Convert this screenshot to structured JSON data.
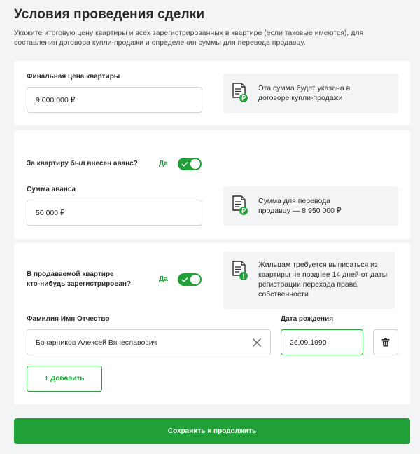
{
  "page": {
    "title": "Условия проведения сделки",
    "subtitle": "Укажите итоговую цену квартиры и всех зарегистрированных в квартире (если таковые имеются), для составления договора купли-продажи и определения суммы для перевода продавцу."
  },
  "price_card": {
    "label": "Финальная цена квартиры",
    "value": "9 000 000 ₽",
    "info_line1": "Эта сумма будет указана в",
    "info_line2": "договоре купли-продажи"
  },
  "advance_card": {
    "question": "За квартиру был внесен аванс?",
    "toggle_state": "Да",
    "amount_label": "Сумма аванса",
    "amount_value": "50 000 ₽",
    "info_line1": "Сумма для перевода",
    "info_line2": "продавцу — 8 950 000 ₽"
  },
  "residents_card": {
    "question_line1": "В продаваемой квартире",
    "question_line2": "кто-нибудь зарегистрирован?",
    "toggle_state": "Да",
    "info_line1": "Жильцам требуется выписаться из",
    "info_line2": "квартиры не позднее 14 дней от даты",
    "info_line3": "регистрации перехода права",
    "info_line4": "собственности",
    "name_label": "Фамилия Имя Отчество",
    "name_value": "Бочарников Алексей Вячеславович",
    "birth_label": "Дата рождения",
    "birth_value": "26.09.1990",
    "add_label": "+ Добавить"
  },
  "actions": {
    "save_label": "Сохранить и продолжить"
  },
  "colors": {
    "accent": "#21a038",
    "background": "#f2f4f5",
    "card": "#ffffff",
    "info_bg": "#f2f4f5"
  },
  "icons": [
    "document-ruble-icon",
    "document-warning-icon",
    "check-icon",
    "close-icon",
    "trash-icon"
  ]
}
